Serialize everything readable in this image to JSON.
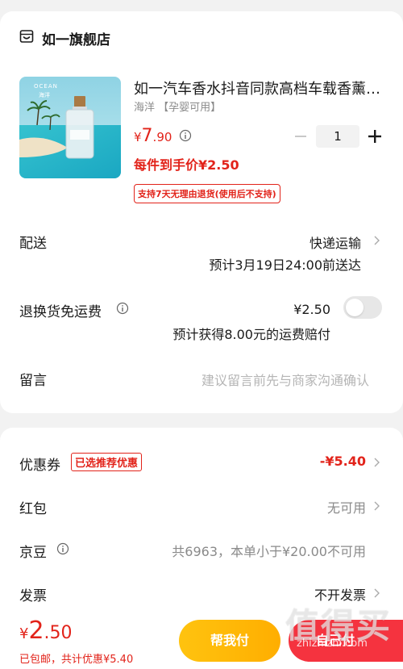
{
  "store": {
    "name": "如一旗舰店",
    "icon": "store-icon"
  },
  "product": {
    "title": "如一汽车香水抖音同款高档车载香薰…",
    "spec": "海洋 【孕婴可用】",
    "thumb_brand": "OCEAN",
    "thumb_sub": "海洋",
    "price_symbol": "¥",
    "price_int": "7",
    "price_dec": ".90",
    "unit_price": "每件到手价¥2.50",
    "return_policy": "支持7天无理由退货(使用后不支持)",
    "quantity": "1"
  },
  "delivery": {
    "label": "配送",
    "method": "快递运输",
    "eta": "预计3月19日24:00前送达"
  },
  "return_shipping": {
    "label": "退换货免运费",
    "price": "¥2.50",
    "note": "预计获得8.00元的运费赔付",
    "enabled": false
  },
  "message": {
    "label": "留言",
    "placeholder": "建议留言前先与商家沟通确认"
  },
  "coupon": {
    "label": "优惠券",
    "tag": "已选推荐优惠",
    "value": "-¥5.40"
  },
  "red_packet": {
    "label": "红包",
    "value": "无可用"
  },
  "jingdou": {
    "label": "京豆",
    "value": "共6963，本单小于¥20.00不可用"
  },
  "invoice": {
    "label": "发票",
    "value": "不开发票"
  },
  "footer": {
    "total_symbol": "¥",
    "total_int": "2",
    "total_dec": ".50",
    "note": "已包邮，共计优惠¥5.40",
    "help_pay": "帮我付",
    "pay": "自己付"
  },
  "watermark": {
    "text": "值得买",
    "domain": "zhizhizhi.com"
  },
  "colors": {
    "accent": "#e2231a",
    "help_button": "#ffc30f",
    "pay_button": "#f5333f"
  }
}
